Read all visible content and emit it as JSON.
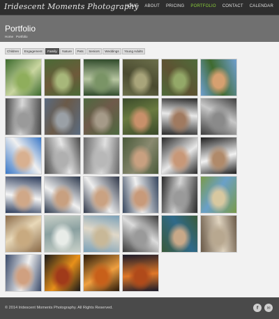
{
  "header": {
    "logo": "Iridescent Moments Photography",
    "nav": [
      {
        "label": "HOME",
        "active": false
      },
      {
        "label": "ABOUT",
        "active": false
      },
      {
        "label": "PRICING",
        "active": false
      },
      {
        "label": "PORTFOLIO",
        "active": true
      },
      {
        "label": "CONTACT",
        "active": false
      },
      {
        "label": "CALENDAR",
        "active": false
      }
    ],
    "active_color": "#8bd03a"
  },
  "banner": {
    "title": "Portfolio",
    "breadcrumb": [
      "Home",
      "Portfolio"
    ]
  },
  "filters": [
    {
      "label": "Children",
      "active": false
    },
    {
      "label": "Engagement",
      "active": false
    },
    {
      "label": "Family",
      "active": true
    },
    {
      "label": "Nature",
      "active": false
    },
    {
      "label": "Pets",
      "active": false
    },
    {
      "label": "Seniors",
      "active": false
    },
    {
      "label": "Weddings",
      "active": false
    },
    {
      "label": "Young Adults",
      "active": false
    }
  ],
  "gallery": {
    "photos": [
      {
        "subject": "family-in-park",
        "colors": [
          "#3d6b2e",
          "#8fae5c",
          "#c9d6a0"
        ]
      },
      {
        "subject": "family-on-log",
        "colors": [
          "#4a6a36",
          "#a7b77a",
          "#6e5a3a"
        ]
      },
      {
        "subject": "kids-in-tree",
        "colors": [
          "#2f4a2a",
          "#7a9466",
          "#b8c7a2"
        ]
      },
      {
        "subject": "tree-trunk",
        "colors": [
          "#6b6f4a",
          "#a8a47a",
          "#4a4a30"
        ]
      },
      {
        "subject": "tree-branches",
        "colors": [
          "#4f6b3a",
          "#93a868",
          "#5e5232"
        ]
      },
      {
        "subject": "father-and-son",
        "colors": [
          "#6f9fd0",
          "#d6a070",
          "#3f6a2f"
        ]
      },
      {
        "subject": "couple-bw",
        "colors": [
          "#4a4a4a",
          "#9a9a9a",
          "#d8d8d8"
        ]
      },
      {
        "subject": "family-on-tracks",
        "colors": [
          "#5a6b80",
          "#9aa0a6",
          "#6b5a48"
        ]
      },
      {
        "subject": "family-on-tracks-2",
        "colors": [
          "#4e6a40",
          "#a59a88",
          "#6f5a4a"
        ]
      },
      {
        "subject": "father-and-son-closeup",
        "colors": [
          "#3a4a2a",
          "#c8906a",
          "#6a7a40"
        ]
      },
      {
        "subject": "couple-portrait",
        "colors": [
          "#2a2a2a",
          "#a07a60",
          "#e8e8e8"
        ]
      },
      {
        "subject": "kids-bw",
        "colors": [
          "#3e3e3e",
          "#8a8a8a",
          "#c8c8c8"
        ]
      },
      {
        "subject": "couple-smiling",
        "colors": [
          "#3a78c8",
          "#d8b090",
          "#f0f0f0"
        ]
      },
      {
        "subject": "mother-and-child-bw",
        "colors": [
          "#4a4a4a",
          "#b0b0b0",
          "#e6e6e6"
        ]
      },
      {
        "subject": "baby-toys-bw",
        "colors": [
          "#6a6a6a",
          "#b8b8b8",
          "#e0e0e0"
        ]
      },
      {
        "subject": "family-outdoors",
        "colors": [
          "#4a5a3a",
          "#c8a080",
          "#8a8a70"
        ]
      },
      {
        "subject": "family-lying-down",
        "colors": [
          "#2a2a2a",
          "#c89878",
          "#e8e8e8"
        ]
      },
      {
        "subject": "family-posed",
        "colors": [
          "#1e1e1e",
          "#b08a6a",
          "#f2f2f2"
        ]
      },
      {
        "subject": "mother-holding-baby",
        "colors": [
          "#2a3a5a",
          "#d0a888",
          "#f4f4f4"
        ]
      },
      {
        "subject": "family-studio",
        "colors": [
          "#2e3a4e",
          "#c8a080",
          "#f0f0f0"
        ]
      },
      {
        "subject": "family-studio-2",
        "colors": [
          "#30384a",
          "#caa282",
          "#eeeeee"
        ]
      },
      {
        "subject": "father-and-kids",
        "colors": [
          "#36465e",
          "#c89a7a",
          "#f0f0f0"
        ]
      },
      {
        "subject": "family-by-car-bw",
        "colors": [
          "#2a2a2a",
          "#9a9a9a",
          "#d4d4d4"
        ]
      },
      {
        "subject": "family-in-field",
        "colors": [
          "#7a9a4a",
          "#d8c8a0",
          "#6aa0c8"
        ]
      },
      {
        "subject": "mother-and-baby-sepia",
        "colors": [
          "#8a6a48",
          "#c8aa80",
          "#e8d8b8"
        ]
      },
      {
        "subject": "family-on-beach-faded",
        "colors": [
          "#c8d0c8",
          "#e8ece8",
          "#8aa0a0"
        ]
      },
      {
        "subject": "family-on-beach",
        "colors": [
          "#7aa0b8",
          "#c8b898",
          "#e0d8c8"
        ]
      },
      {
        "subject": "family-sitting-bw",
        "colors": [
          "#3a3a3a",
          "#9a9a9a",
          "#dcdcdc"
        ]
      },
      {
        "subject": "couple-outdoors",
        "colors": [
          "#3a5a3a",
          "#c8a888",
          "#2f6a8a"
        ]
      },
      {
        "subject": "family-sepia",
        "colors": [
          "#6a5a48",
          "#b8a890",
          "#e0d4c0"
        ]
      },
      {
        "subject": "mother-and-daughters",
        "colors": [
          "#3a4a6a",
          "#d0a080",
          "#f0f0f0"
        ]
      },
      {
        "subject": "sunset-silhouette",
        "colors": [
          "#1a1a1a",
          "#a03a1a",
          "#e8901a"
        ]
      },
      {
        "subject": "sunset-family",
        "colors": [
          "#2a1a0a",
          "#c8601a",
          "#f0a040"
        ]
      },
      {
        "subject": "sunset-couple",
        "colors": [
          "#1a1a2a",
          "#b04a1a",
          "#e07828"
        ]
      }
    ]
  },
  "footer": {
    "copyright": "© 2014 Iridescent Moments Photography. All Rights Reserved.",
    "social": [
      {
        "icon": "facebook-icon",
        "glyph": "f"
      },
      {
        "icon": "email-icon",
        "glyph": "✉"
      }
    ]
  }
}
